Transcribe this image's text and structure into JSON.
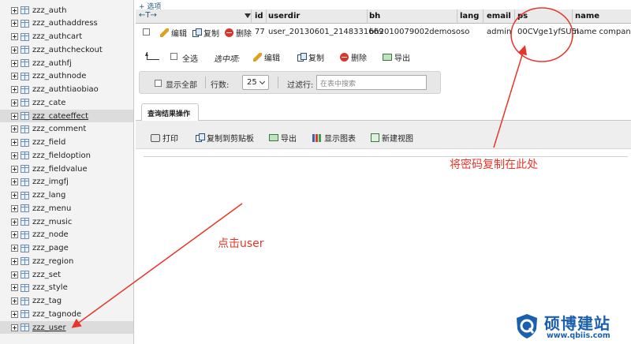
{
  "sidebar": {
    "tables": [
      "zzz_auth",
      "zzz_authaddress",
      "zzz_authcart",
      "zzz_authcheckout",
      "zzz_authfj",
      "zzz_authnode",
      "zzz_authtiaobiao",
      "zzz_cate",
      "zzz_cateeffect",
      "zzz_comment",
      "zzz_field",
      "zzz_fieldoption",
      "zzz_fieldvalue",
      "zzz_imgfj",
      "zzz_lang",
      "zzz_menu",
      "zzz_music",
      "zzz_node",
      "zzz_page",
      "zzz_region",
      "zzz_set",
      "zzz_style",
      "zzz_tag",
      "zzz_tagnode",
      "zzz_user"
    ],
    "highlighted": [
      "zzz_cateeffect",
      "zzz_user"
    ]
  },
  "options_link": "+ 选项",
  "grid": {
    "nav_arrows": "←T→",
    "columns": [
      "id",
      "userdir",
      "bh",
      "lang",
      "email",
      "ps",
      "name"
    ],
    "row": {
      "edit": "编辑",
      "copy": "复制",
      "delete": "删除",
      "id": "77",
      "userdir": "user_20130601_2148331669",
      "bh": "bh2010079002demososo",
      "lang": "",
      "email": "admin",
      "ps": "00CVge1yfSU5I",
      "name": "name company"
    }
  },
  "bulk": {
    "select_all": "全选",
    "with_selected": "选中项:",
    "edit": "编辑",
    "copy": "复制",
    "delete": "删除",
    "export": "导出"
  },
  "filter": {
    "show_all": "显示全部",
    "rows_label": "行数:",
    "rows_value": "25",
    "filter_label": "过滤行:",
    "filter_placeholder": "在表中搜索"
  },
  "ops": {
    "tab": "查询结果操作",
    "print": "打印",
    "copy_clipboard": "复制到剪贴板",
    "export": "导出",
    "chart": "显示图表",
    "new_view": "新建视图"
  },
  "annotations": {
    "copy_password": "将密码复制在此处",
    "click_user": "点击user",
    "color": "#e8352a"
  },
  "watermark": {
    "title": "硕博建站",
    "url": "www.qbiis.com"
  },
  "colors": {
    "sidebar_bg": "#f3f3f3",
    "header_bg": "#eaeaea",
    "link_blue": "#235a81",
    "brand_blue": "#1b5fb1"
  }
}
